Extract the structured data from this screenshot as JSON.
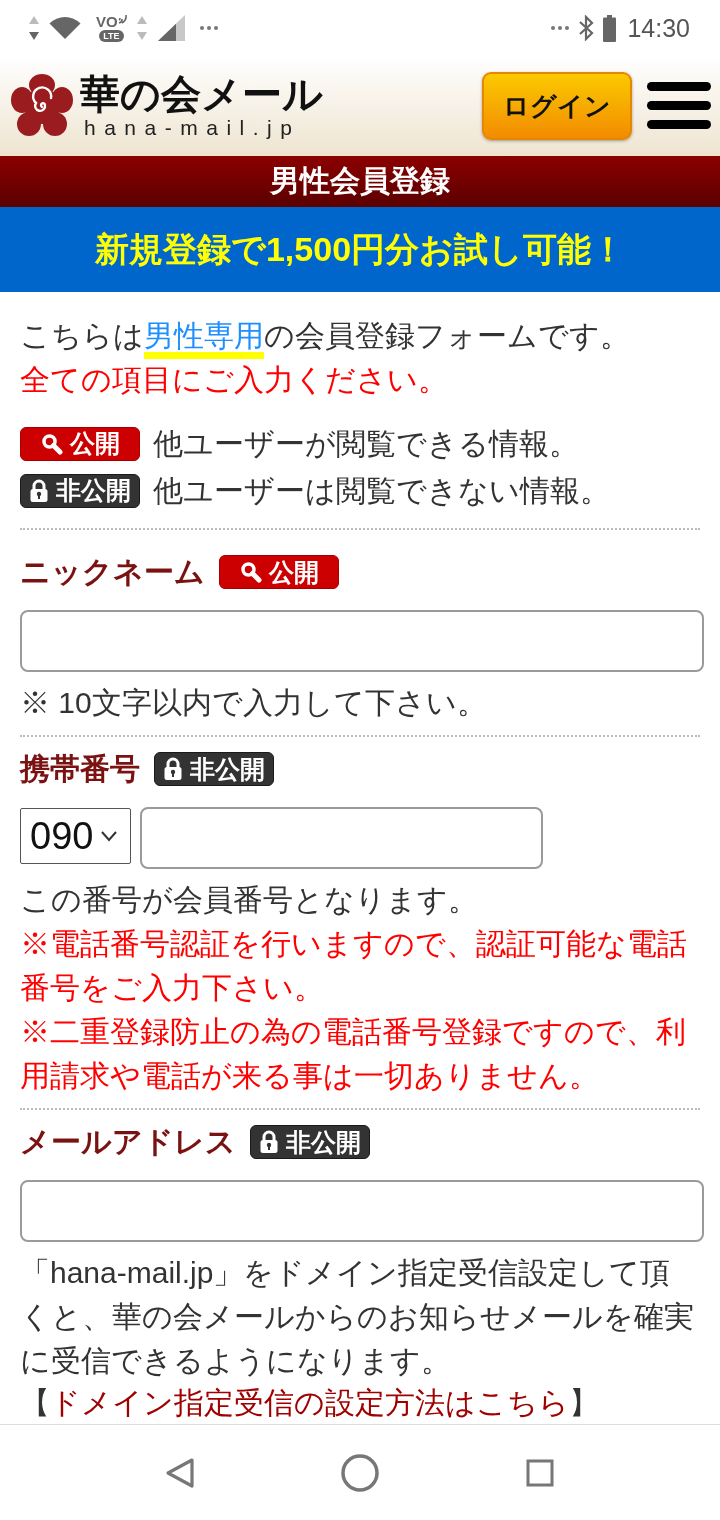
{
  "status_bar": {
    "call_label": "VO",
    "network_type": "LTE",
    "time": "14:30"
  },
  "header": {
    "logo_title": "華の会メール",
    "logo_domain": "hana-mail.jp",
    "login_button": "ログイン"
  },
  "page_title": "男性会員登録",
  "promo_banner": "新規登録で1,500円分お試し可能！",
  "intro": {
    "before": "こちらは",
    "link": "男性専用",
    "after": "の会員登録フォームです。"
  },
  "required_note": "全ての項目にご入力ください。",
  "legend": [
    {
      "badge": {
        "kind": "public",
        "label": "公開"
      },
      "description": "他ユーザーが閲覧できる情報。"
    },
    {
      "badge": {
        "kind": "private",
        "label": "非公開"
      },
      "description": "他ユーザーは閲覧できない情報。"
    }
  ],
  "fields": [
    {
      "kind": "text",
      "label": "ニックネーム",
      "badge": {
        "kind": "public",
        "label": "公開"
      },
      "notes": [
        {
          "kind": "plain",
          "text": "※ 10文字以内で入力して下さい。"
        }
      ]
    },
    {
      "kind": "phone",
      "label": "携帯番号",
      "badge": {
        "kind": "private",
        "label": "非公開"
      },
      "prefix": "090",
      "notes": [
        {
          "kind": "plain",
          "text": "この番号が会員番号となります。"
        },
        {
          "kind": "warning",
          "text": "※電話番号認証を行いますので、認証可能な電話番号をご入力下さい。"
        },
        {
          "kind": "warning",
          "text": "※二重登録防止の為の電話番号登録ですので、利用請求や電話が来る事は一切ありません。"
        }
      ]
    },
    {
      "kind": "text",
      "label": "メールアドレス",
      "badge": {
        "kind": "private",
        "label": "非公開"
      },
      "notes": [
        {
          "kind": "plain",
          "text": "「hana-mail.jp」をドメイン指定受信設定して頂くと、華の会メールからのお知らせメールを確実に受信できるようになります。"
        },
        {
          "kind": "link",
          "before": "【",
          "link": "ドメイン指定受信の設定方法はこちら",
          "after": "】"
        }
      ]
    }
  ]
}
